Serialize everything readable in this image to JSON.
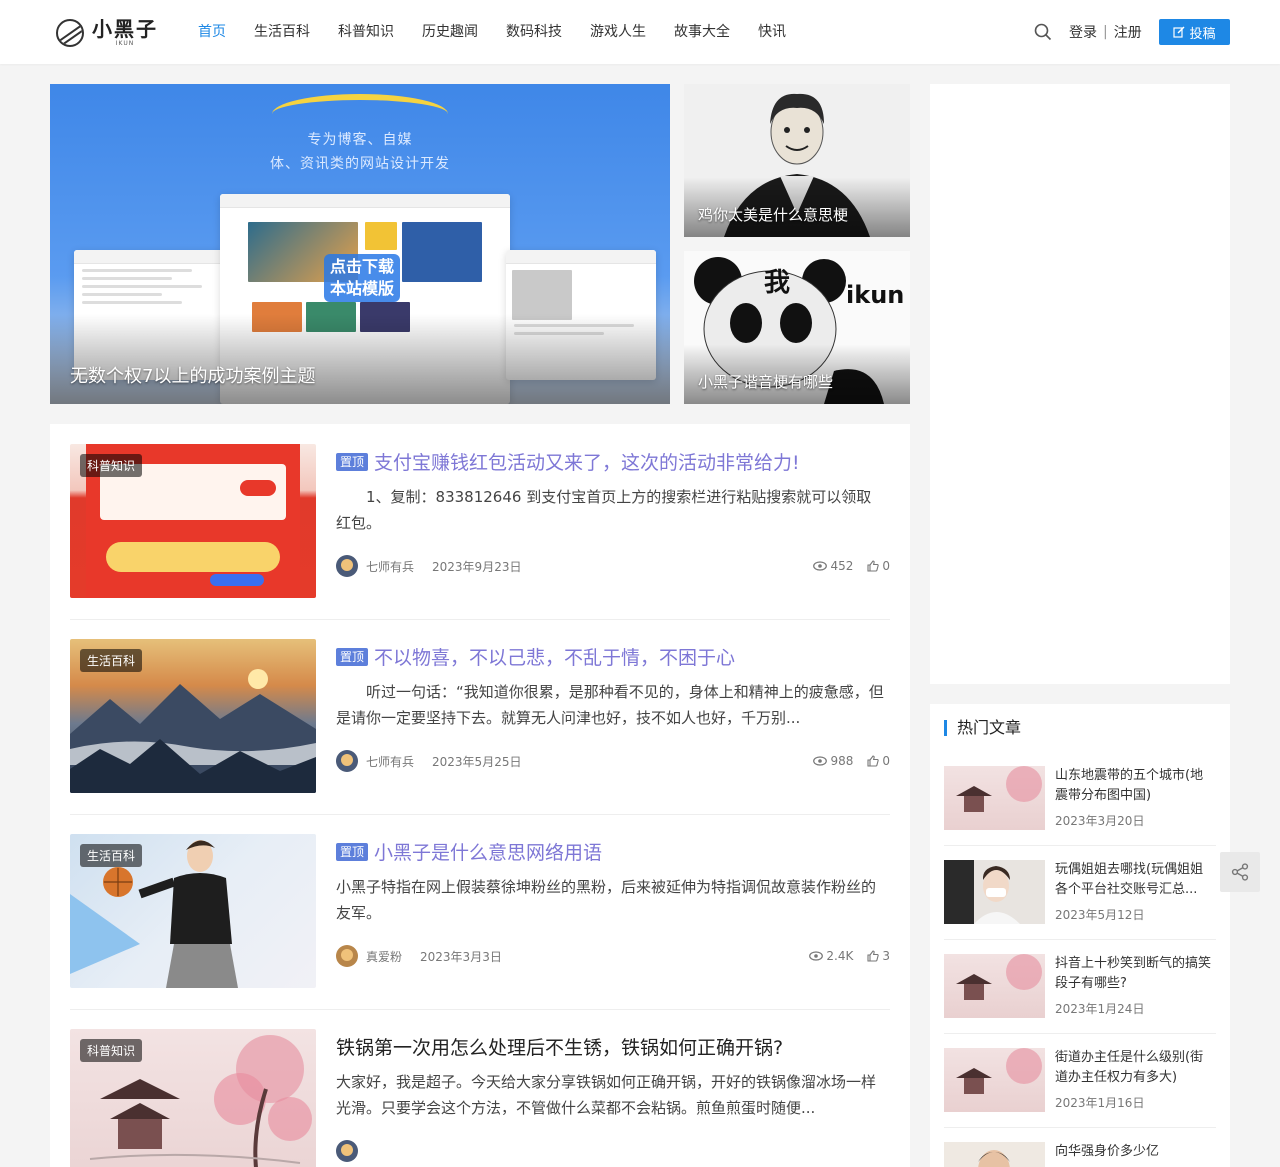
{
  "header": {
    "logo_title": "小黑子",
    "logo_sub": "IKUN",
    "nav": [
      "首页",
      "生活百科",
      "科普知识",
      "历史趣闻",
      "数码科技",
      "游戏人生",
      "故事大全",
      "快讯"
    ],
    "login": "登录",
    "register": "注册",
    "submit": "投稿"
  },
  "banner": {
    "slogan_line1": "专为博客、自媒",
    "slogan_line2": "体、资讯类的网站设计开发",
    "download_label": "点击下载本站模版",
    "main_caption": "无数个权7以上的成功案例主题",
    "side1_caption": "鸡你太美是什么意思梗",
    "side2_caption": "小黑子谐音梗有哪些"
  },
  "posts": [
    {
      "tag": "科普知识",
      "pin": "置顶",
      "title": "支付宝赚钱红包活动又来了，这次的活动非常给力!",
      "excerpt": "　　1、复制：833812646 到支付宝首页上方的搜索栏进行粘贴搜索就可以领取红包。",
      "author": "七师有兵",
      "date": "2023年9月23日",
      "views": "452",
      "likes": "0"
    },
    {
      "tag": "生活百科",
      "pin": "置顶",
      "title": "不以物喜，不以己悲，不乱于情，不困于心",
      "excerpt": "　　听过一句话：“我知道你很累，是那种看不见的，身体上和精神上的疲惫感，但是请你一定要坚持下去。就算无人问津也好，技不如人也好，千万别...",
      "author": "七师有兵",
      "date": "2023年5月25日",
      "views": "988",
      "likes": "0"
    },
    {
      "tag": "生活百科",
      "pin": "置顶",
      "title": "小黑子是什么意思网络用语",
      "excerpt": "小黑子特指在网上假装蔡徐坤粉丝的黑粉，后来被延伸为特指调侃故意装作粉丝的友军。",
      "author": "真爱粉",
      "date": "2023年3月3日",
      "views": "2.4K",
      "likes": "3"
    },
    {
      "tag": "科普知识",
      "pin": "",
      "title": "铁锅第一次用怎么处理后不生锈，铁锅如何正确开锅?",
      "excerpt": "大家好，我是超子。今天给大家分享铁锅如何正确开锅，开好的铁锅像溜冰场一样光滑。只要学会这个方法，不管做什么菜都不会粘锅。煎鱼煎蛋时随便...",
      "author": "",
      "date": "",
      "views": "",
      "likes": ""
    }
  ],
  "hot": {
    "title": "热门文章",
    "items": [
      {
        "title": "山东地震带的五个城市(地震带分布图中国)",
        "date": "2023年3月20日"
      },
      {
        "title": "玩偶姐姐去哪找(玩偶姐姐各个平台社交账号汇总...",
        "date": "2023年5月12日"
      },
      {
        "title": "抖音上十秒笑到断气的搞笑段子有哪些?",
        "date": "2023年1月24日"
      },
      {
        "title": "街道办主任是什么级别(街道办主任权力有多大)",
        "date": "2023年1月16日"
      },
      {
        "title": "向华强身价多少亿",
        "date": ""
      }
    ]
  },
  "colors": {
    "accent": "#1e88e5",
    "title_link": "#7e77d6",
    "pin_badge": "#5d7fdb"
  }
}
